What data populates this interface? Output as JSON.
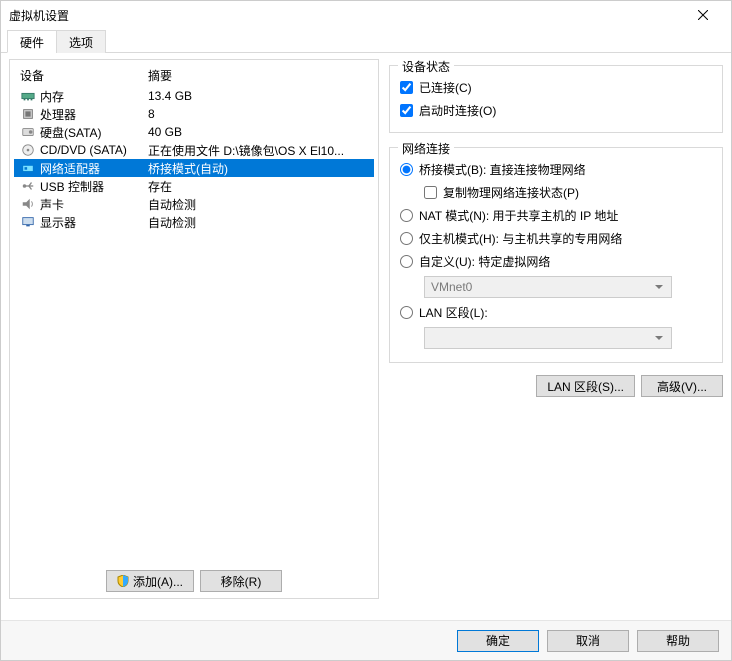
{
  "window": {
    "title": "虚拟机设置"
  },
  "tabs": {
    "hardware": "硬件",
    "options": "选项"
  },
  "hw_header": {
    "device": "设备",
    "summary": "摘要"
  },
  "hw": [
    {
      "icon": "memory-icon",
      "name": "内存",
      "summary": "13.4 GB"
    },
    {
      "icon": "cpu-icon",
      "name": "处理器",
      "summary": "8"
    },
    {
      "icon": "disk-icon",
      "name": "硬盘(SATA)",
      "summary": "40 GB"
    },
    {
      "icon": "cd-icon",
      "name": "CD/DVD (SATA)",
      "summary": "正在使用文件 D:\\镜像包\\OS X El10..."
    },
    {
      "icon": "nic-icon",
      "name": "网络适配器",
      "summary": "桥接模式(自动)"
    },
    {
      "icon": "usb-icon",
      "name": "USB 控制器",
      "summary": "存在"
    },
    {
      "icon": "sound-icon",
      "name": "声卡",
      "summary": "自动检测"
    },
    {
      "icon": "display-icon",
      "name": "显示器",
      "summary": "自动检测"
    }
  ],
  "buttons": {
    "add": "添加(A)...",
    "remove": "移除(R)",
    "lan_segments": "LAN 区段(S)...",
    "advanced": "高级(V)...",
    "ok": "确定",
    "cancel": "取消",
    "help": "帮助"
  },
  "status_box": {
    "title": "设备状态",
    "connected": "已连接(C)",
    "connect_at_poweron": "启动时连接(O)"
  },
  "net_box": {
    "title": "网络连接",
    "bridged": "桥接模式(B): 直接连接物理网络",
    "replicate": "复制物理网络连接状态(P)",
    "nat": "NAT 模式(N): 用于共享主机的 IP 地址",
    "hostonly": "仅主机模式(H): 与主机共享的专用网络",
    "custom": "自定义(U): 特定虚拟网络",
    "custom_value": "VMnet0",
    "lan_segment": "LAN 区段(L):"
  }
}
